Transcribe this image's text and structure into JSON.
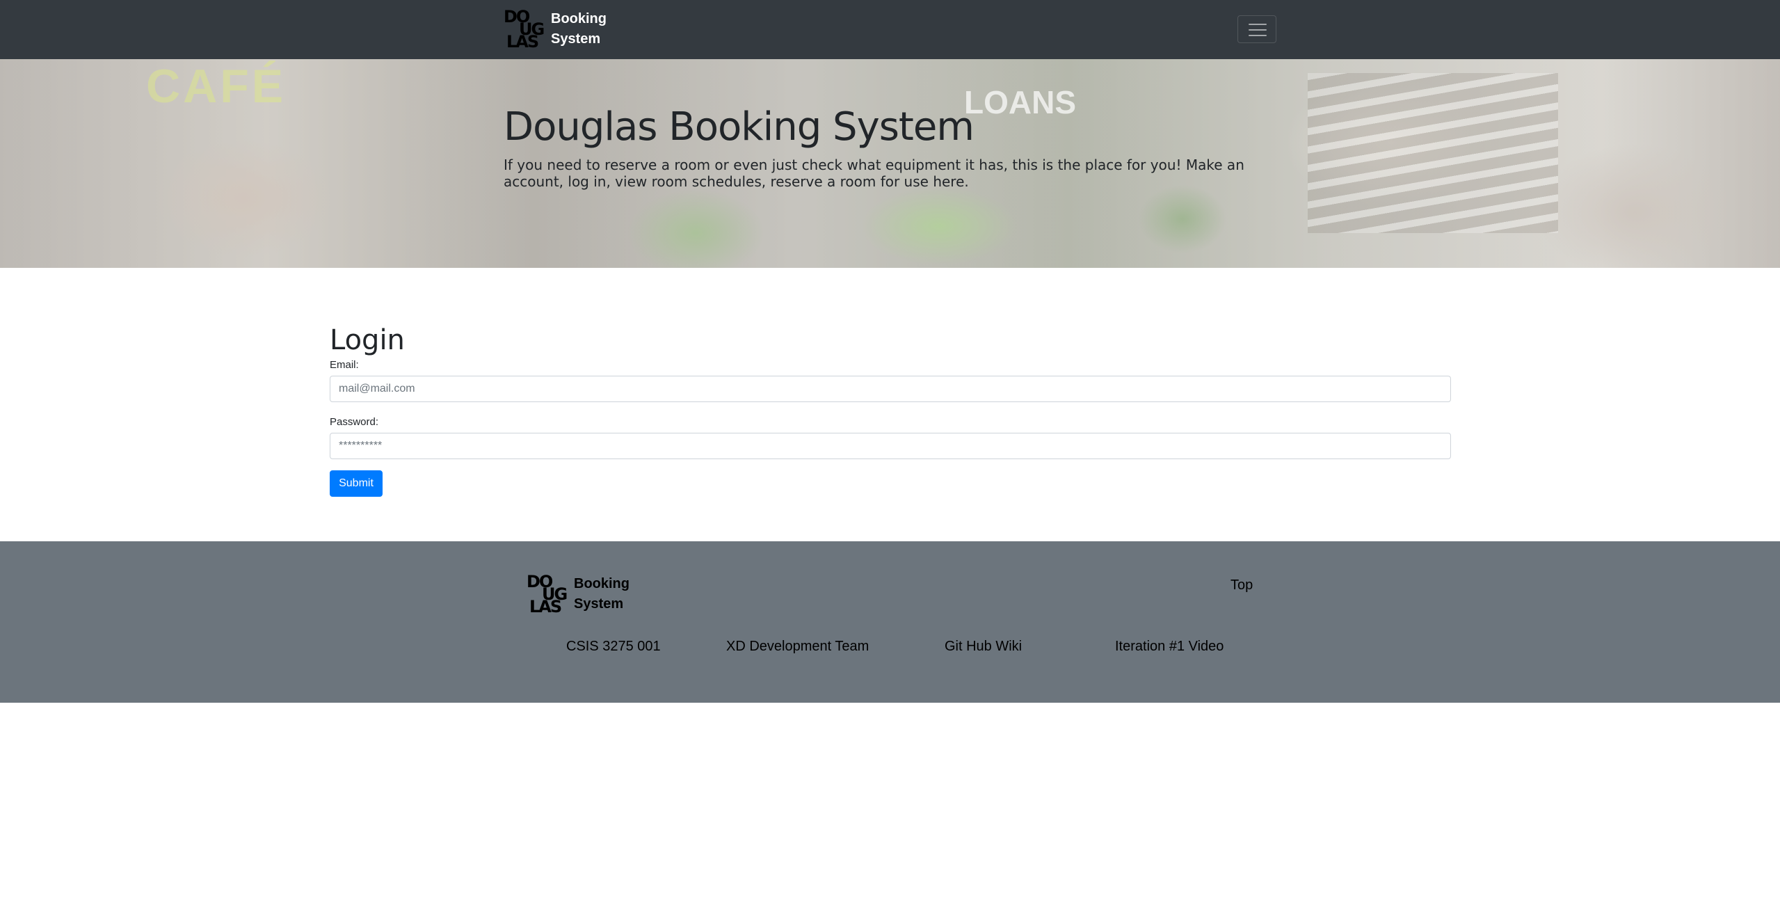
{
  "navbar": {
    "logo_text": [
      "DO",
      "UG",
      "LAS"
    ],
    "brand_line1": "Booking",
    "brand_line2": "System",
    "menu_icon": "hamburger-icon"
  },
  "hero": {
    "title": "Douglas Booking System",
    "lead": "If you need to reserve a room or even just check what equipment it has, this is the place for you! Make an account, log in, view room schedules, reserve a room for use here.",
    "background_sign_1": "CAFÉ",
    "background_sign_2": "LOANS"
  },
  "login": {
    "heading": "Login",
    "email_label": "Email:",
    "email_placeholder": "mail@mail.com",
    "password_label": "Password:",
    "password_placeholder": "**********",
    "submit_label": "Submit"
  },
  "footer": {
    "brand_line1": "Booking",
    "brand_line2": "System",
    "top_link": "Top",
    "links": [
      "CSIS 3275 001",
      "XD Development Team",
      "Git Hub Wiki",
      "Iteration #1 Video"
    ]
  },
  "colors": {
    "navbar_bg": "#343a40",
    "footer_bg": "#6c757d",
    "primary": "#007bff"
  }
}
